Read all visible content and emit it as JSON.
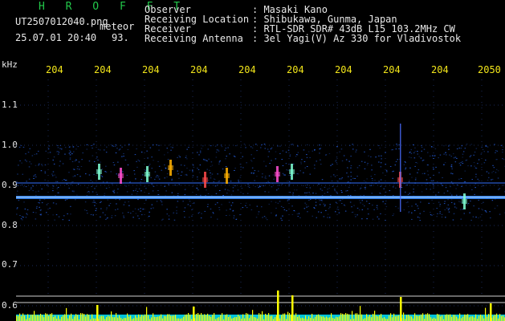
{
  "header": {
    "app_title": "H R O F F T",
    "filename": "UT2507012040.png",
    "mode": "meteor",
    "datetime": "25.07.01 20:40",
    "count": "93.",
    "observer_label": "Observer",
    "observer_value": ": Masaki Kano",
    "location_label": "Receiving Location",
    "location_value": ": Shibukawa, Gunma, Japan",
    "receiver_label": "Receiver",
    "receiver_value": ": RTL-SDR SDR# 43dB L15 103.2MHz CW",
    "antenna_label": "Receiving Antenna",
    "antenna_value": ": 3el Yagi(V) Az 330 for Vladivostok"
  },
  "axes": {
    "y_unit": "kHz",
    "y_ticks": [
      "1.1",
      "1.0",
      "0.9",
      "0.8",
      "0.7",
      "0.6"
    ],
    "x_ticks": [
      "204",
      "204",
      "204",
      "204",
      "204",
      "204",
      "204",
      "204",
      "204",
      "2050"
    ]
  },
  "colors": {
    "background": "#000000",
    "title": "#22c84a",
    "text": "#e8e8e8",
    "time_labels": "#f2e51a",
    "signal": "#2a6cff",
    "bars": "#ffff00",
    "baseline": "#00e5ff"
  }
}
